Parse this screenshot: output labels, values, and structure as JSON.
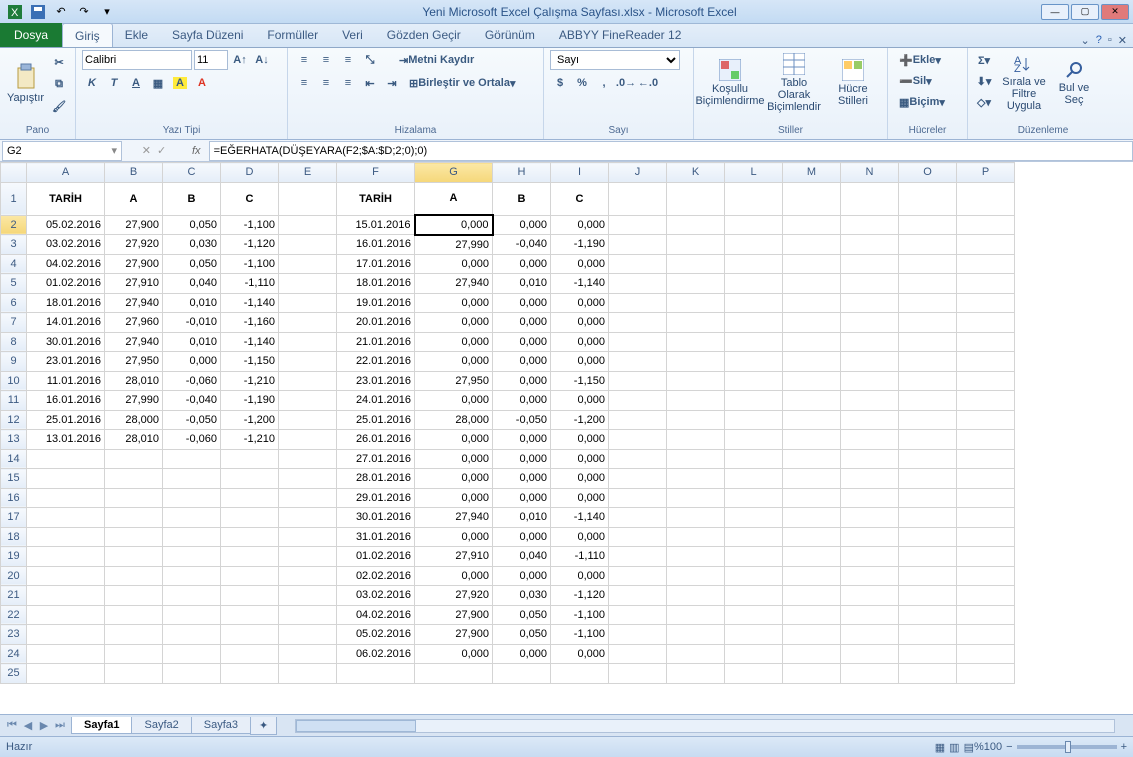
{
  "title": "Yeni Microsoft Excel Çalışma Sayfası.xlsx - Microsoft Excel",
  "tabs": {
    "file": "Dosya",
    "home": "Giriş",
    "insert": "Ekle",
    "layout": "Sayfa Düzeni",
    "formulas": "Formüller",
    "data": "Veri",
    "review": "Gözden Geçir",
    "view": "Görünüm",
    "abbyy": "ABBYY FineReader 12"
  },
  "ribbon": {
    "paste": "Yapıştır",
    "clipboard": "Pano",
    "font_name": "Calibri",
    "font_size": "11",
    "font_group": "Yazı Tipi",
    "wrap": "Metni Kaydır",
    "merge": "Birleştir ve Ortala",
    "align_group": "Hizalama",
    "numfmt": "Sayı",
    "num_group": "Sayı",
    "cond": "Koşullu Biçimlendirme",
    "astable": "Tablo Olarak Biçimlendir",
    "cellstyle": "Hücre Stilleri",
    "styles_group": "Stiller",
    "ins": "Ekle",
    "del": "Sil",
    "fmt": "Biçim",
    "cells_group": "Hücreler",
    "sortfilter": "Sırala ve Filtre Uygula",
    "findsel": "Bul ve Seç",
    "edit_group": "Düzenleme"
  },
  "name_box": "G2",
  "formula": "=EĞERHATA(DÜŞEYARA(F2;$A:$D;2;0);0)",
  "cols": [
    "A",
    "B",
    "C",
    "D",
    "E",
    "F",
    "G",
    "H",
    "I",
    "J",
    "K",
    "L",
    "M",
    "N",
    "O",
    "P"
  ],
  "hdr1": {
    "A": "TARİH",
    "B": "A",
    "C": "B",
    "D": "C",
    "F": "TARİH",
    "G": "A",
    "H": "B",
    "I": "C"
  },
  "rows": [
    {
      "A": "05.02.2016",
      "B": "27,900",
      "C": "0,050",
      "D": "-1,100",
      "F": "15.01.2016",
      "G": "0,000",
      "H": "0,000",
      "I": "0,000"
    },
    {
      "A": "03.02.2016",
      "B": "27,920",
      "C": "0,030",
      "D": "-1,120",
      "F": "16.01.2016",
      "G": "27,990",
      "H": "-0,040",
      "I": "-1,190"
    },
    {
      "A": "04.02.2016",
      "B": "27,900",
      "C": "0,050",
      "D": "-1,100",
      "F": "17.01.2016",
      "G": "0,000",
      "H": "0,000",
      "I": "0,000"
    },
    {
      "A": "01.02.2016",
      "B": "27,910",
      "C": "0,040",
      "D": "-1,110",
      "F": "18.01.2016",
      "G": "27,940",
      "H": "0,010",
      "I": "-1,140"
    },
    {
      "A": "18.01.2016",
      "B": "27,940",
      "C": "0,010",
      "D": "-1,140",
      "F": "19.01.2016",
      "G": "0,000",
      "H": "0,000",
      "I": "0,000"
    },
    {
      "A": "14.01.2016",
      "B": "27,960",
      "C": "-0,010",
      "D": "-1,160",
      "F": "20.01.2016",
      "G": "0,000",
      "H": "0,000",
      "I": "0,000"
    },
    {
      "A": "30.01.2016",
      "B": "27,940",
      "C": "0,010",
      "D": "-1,140",
      "F": "21.01.2016",
      "G": "0,000",
      "H": "0,000",
      "I": "0,000"
    },
    {
      "A": "23.01.2016",
      "B": "27,950",
      "C": "0,000",
      "D": "-1,150",
      "F": "22.01.2016",
      "G": "0,000",
      "H": "0,000",
      "I": "0,000"
    },
    {
      "A": "11.01.2016",
      "B": "28,010",
      "C": "-0,060",
      "D": "-1,210",
      "F": "23.01.2016",
      "G": "27,950",
      "H": "0,000",
      "I": "-1,150"
    },
    {
      "A": "16.01.2016",
      "B": "27,990",
      "C": "-0,040",
      "D": "-1,190",
      "F": "24.01.2016",
      "G": "0,000",
      "H": "0,000",
      "I": "0,000"
    },
    {
      "A": "25.01.2016",
      "B": "28,000",
      "C": "-0,050",
      "D": "-1,200",
      "F": "25.01.2016",
      "G": "28,000",
      "H": "-0,050",
      "I": "-1,200"
    },
    {
      "A": "13.01.2016",
      "B": "28,010",
      "C": "-0,060",
      "D": "-1,210",
      "F": "26.01.2016",
      "G": "0,000",
      "H": "0,000",
      "I": "0,000"
    },
    {
      "F": "27.01.2016",
      "G": "0,000",
      "H": "0,000",
      "I": "0,000"
    },
    {
      "F": "28.01.2016",
      "G": "0,000",
      "H": "0,000",
      "I": "0,000"
    },
    {
      "F": "29.01.2016",
      "G": "0,000",
      "H": "0,000",
      "I": "0,000"
    },
    {
      "F": "30.01.2016",
      "G": "27,940",
      "H": "0,010",
      "I": "-1,140"
    },
    {
      "F": "31.01.2016",
      "G": "0,000",
      "H": "0,000",
      "I": "0,000"
    },
    {
      "F": "01.02.2016",
      "G": "27,910",
      "H": "0,040",
      "I": "-1,110"
    },
    {
      "F": "02.02.2016",
      "G": "0,000",
      "H": "0,000",
      "I": "0,000"
    },
    {
      "F": "03.02.2016",
      "G": "27,920",
      "H": "0,030",
      "I": "-1,120"
    },
    {
      "F": "04.02.2016",
      "G": "27,900",
      "H": "0,050",
      "I": "-1,100"
    },
    {
      "F": "05.02.2016",
      "G": "27,900",
      "H": "0,050",
      "I": "-1,100"
    },
    {
      "F": "06.02.2016",
      "G": "0,000",
      "H": "0,000",
      "I": "0,000"
    }
  ],
  "sheet_tabs": [
    "Sayfa1",
    "Sayfa2",
    "Sayfa3"
  ],
  "status": "Hazır",
  "zoom": "%100"
}
